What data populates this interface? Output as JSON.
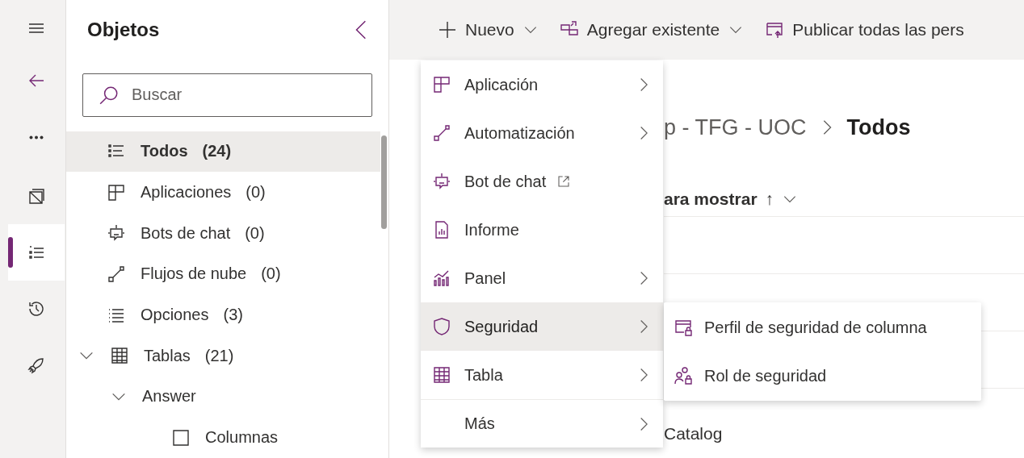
{
  "rail": {
    "items": [
      {
        "kind": "menu",
        "selected": false
      },
      {
        "kind": "back",
        "selected": false
      },
      {
        "kind": "more",
        "selected": false
      },
      {
        "kind": "box",
        "selected": false
      },
      {
        "kind": "list",
        "selected": true
      },
      {
        "kind": "history",
        "selected": false
      },
      {
        "kind": "rocket",
        "selected": false
      }
    ]
  },
  "objects_panel": {
    "title": "Objetos",
    "search": {
      "placeholder": "Buscar"
    },
    "tree": [
      {
        "kind": "list",
        "label": "Todos",
        "count": "(24)",
        "selected": true
      },
      {
        "kind": "app",
        "label": "Aplicaciones",
        "count": "(0)",
        "selected": false
      },
      {
        "kind": "bot",
        "label": "Bots de chat",
        "count": "(0)",
        "selected": false
      },
      {
        "kind": "flow",
        "label": "Flujos de nube",
        "count": "(0)",
        "selected": false
      },
      {
        "kind": "options",
        "label": "Opciones",
        "count": "(3)",
        "selected": false
      },
      {
        "kind": "table",
        "label": "Tablas",
        "count": "(21)",
        "selected": false,
        "expanded": true,
        "children": [
          {
            "label": "Answer",
            "selected": false,
            "expanded": true,
            "children": [
              {
                "kind": "columns",
                "label": "Columnas",
                "selected": false
              }
            ]
          }
        ]
      }
    ]
  },
  "toolbar": [
    {
      "kind": "plus",
      "label": "Nuevo",
      "dropdown": true
    },
    {
      "kind": "add",
      "label": "Agregar existente",
      "dropdown": true
    },
    {
      "kind": "publish",
      "label": "Publicar todas las pers",
      "dropdown": false
    }
  ],
  "content": {
    "breadcrumb": [
      "p - TFG - UOC",
      "Todos"
    ],
    "sort_header": {
      "label": "ara mostrar",
      "arrow": "↑"
    },
    "rows": [
      {},
      {},
      {},
      {
        "name": "Catalog"
      }
    ]
  },
  "new_menu": {
    "items": [
      {
        "kind": "app",
        "label": "Aplicación",
        "submenu": true,
        "external": false,
        "selected": false
      },
      {
        "kind": "flow",
        "label": "Automatización",
        "submenu": true,
        "external": false,
        "selected": false
      },
      {
        "kind": "bot",
        "label": "Bot de chat",
        "submenu": false,
        "external": true,
        "selected": false
      },
      {
        "kind": "report",
        "label": "Informe",
        "submenu": false,
        "external": false,
        "selected": false
      },
      {
        "kind": "dashboard",
        "label": "Panel",
        "submenu": true,
        "external": false,
        "selected": false
      },
      {
        "kind": "shield",
        "label": "Seguridad",
        "submenu": true,
        "external": false,
        "selected": true
      },
      {
        "kind": "table",
        "label": "Tabla",
        "submenu": true,
        "external": false,
        "selected": false
      },
      {
        "label": "Más",
        "submenu": true,
        "external": false,
        "selected": false
      }
    ]
  },
  "security_submenu": {
    "items": [
      {
        "kind": "column-lock",
        "label": "Perfil de seguridad de columna"
      },
      {
        "kind": "role",
        "label": "Rol de seguridad"
      }
    ]
  }
}
